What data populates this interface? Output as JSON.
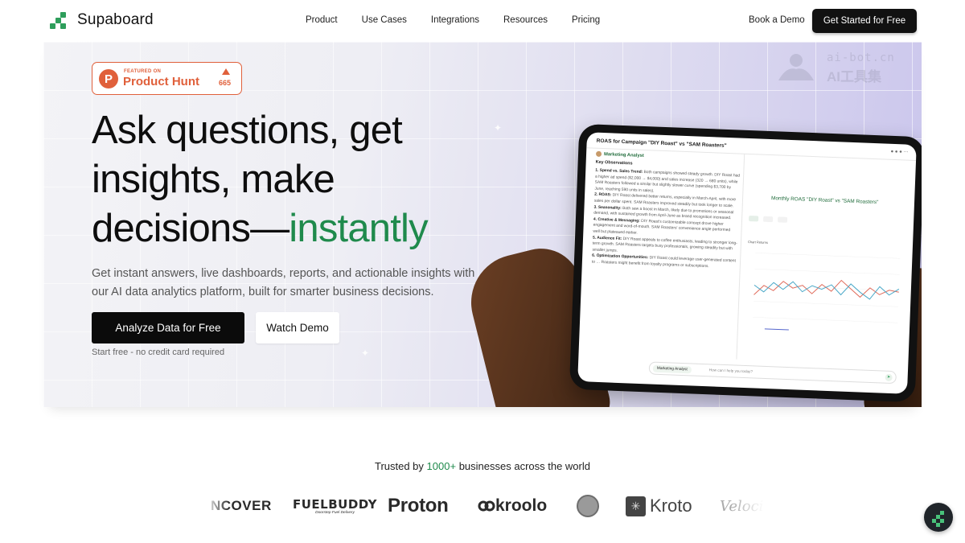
{
  "brand": {
    "name": "Supaboard",
    "accent": "#1f8a4c",
    "logo_icon": "supaboard-logo-icon"
  },
  "nav": {
    "links": [
      "Product",
      "Use Cases",
      "Integrations",
      "Resources",
      "Pricing"
    ],
    "book_demo": "Book a Demo",
    "cta": "Get Started for Free"
  },
  "hero": {
    "badge": {
      "featured": "FEATURED ON",
      "name": "Product Hunt",
      "letter": "P",
      "votes": "665",
      "color": "#e0603b"
    },
    "headline_1": "Ask questions, get",
    "headline_2": "insights, make",
    "headline_3": "decisions—",
    "headline_accent": "instantly",
    "subtext": "Get instant answers, live dashboards, reports, and actionable insights with our AI data analytics platform, built for smarter business decisions.",
    "primary_button": "Analyze Data for Free",
    "secondary_button": "Watch Demo",
    "note": "Start free - no credit card required"
  },
  "watermark": {
    "line1": "ai-bot.cn",
    "line2": "AI工具集"
  },
  "tablet": {
    "title": "ROAS for Campaign \"DIY Roast\" vs \"SAM Roasters\"",
    "agent": "Marketing Analyst",
    "observations_heading": "Key Observations",
    "observations": [
      {
        "label": "1. Spend vs. Sales Trend:",
        "text": "Both campaigns showed steady growth. DIY Roast had a higher ad spend ($2,000 → $4,000) and sales increase (320 → 680 units), while SAM Roasters followed a similar but slightly slower curve (spending $3,700 by June, reaching 590 units in sales)."
      },
      {
        "label": "2. ROAS:",
        "text": "DIY Roast delivered better returns, especially in March-April, with more sales per dollar spent. SAM Roasters improved steadily but took longer to scale."
      },
      {
        "label": "3. Seasonality:",
        "text": "Both saw a boost in March, likely due to promotions or seasonal demand, with sustained growth from April-June as brand recognition increased."
      },
      {
        "label": "4. Creative & Messaging:",
        "text": "DIY Roast's customizable concept drove higher engagement and word-of-mouth. SAM Roasters' convenience angle performed well but plateaued earlier."
      },
      {
        "label": "5. Audience Fit:",
        "text": "DIY Roast appeals to coffee enthusiasts, leading to stronger long-term growth. SAM Roasters targets busy professionals, growing steadily but with smaller jumps."
      },
      {
        "label": "6. Optimization Opportunities:",
        "text": "DIY Roast could leverage user-generated content to … Roasters might benefit from loyalty programs or subscriptions."
      }
    ],
    "chart_title": "Monthly ROAS \"DIY Roast\" vs \"SAM Roasters\"",
    "chart_label": "Chart Returns",
    "composer_chip": "Marketing Analyst",
    "composer_placeholder": "How can I help you today?",
    "series_colors": {
      "diy_roast": "#e06b5b",
      "sam_roasters": "#4aa8c8"
    }
  },
  "trusted": {
    "prefix": "Trusted by",
    "count": "1000+",
    "suffix": "businesses across the world"
  },
  "logos": {
    "ncover": "NCOVER",
    "fuelbuddy": "FUELBUDDY",
    "fuelbuddy_tagline": "Doorstep Fuel Delivery",
    "proton": "Proton",
    "kroolo": "kroolo",
    "kroto": "Kroto",
    "veloci": "Veloci"
  },
  "chat_widget_icon": "supaboard-chat-icon"
}
